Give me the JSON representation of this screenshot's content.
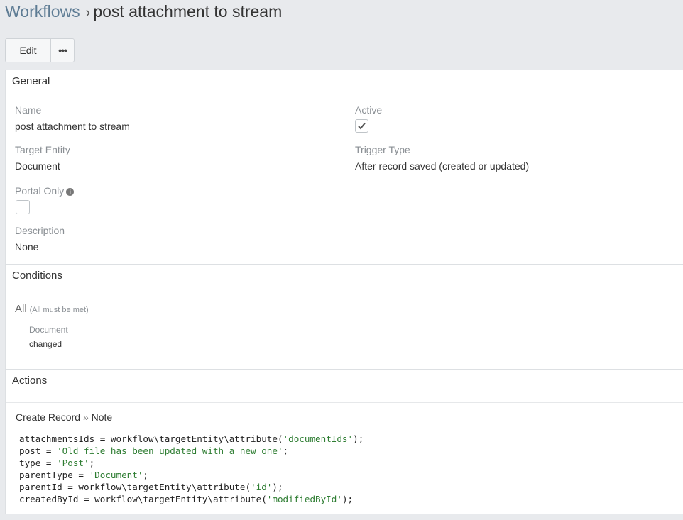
{
  "header": {
    "breadcrumb_link": "Workflows",
    "separator": "›",
    "title": "post attachment to stream"
  },
  "toolbar": {
    "edit_label": "Edit",
    "more_label": "•••"
  },
  "general": {
    "heading": "General",
    "name_label": "Name",
    "name_value": "post attachment to stream",
    "active_label": "Active",
    "active_checked": true,
    "target_entity_label": "Target Entity",
    "target_entity_value": "Document",
    "trigger_type_label": "Trigger Type",
    "trigger_type_value": "After record saved (created or updated)",
    "portal_only_label": "Portal Only",
    "portal_only_info_icon": "i",
    "portal_only_checked": false,
    "description_label": "Description",
    "description_value": "None"
  },
  "conditions": {
    "heading": "Conditions",
    "group_label": "All",
    "group_hint": "(All must be met)",
    "field_label": "Document",
    "field_value": "changed"
  },
  "actions": {
    "heading": "Actions",
    "action_type": "Create Record",
    "action_sep": "»",
    "action_target": "Note",
    "code_lines": [
      {
        "pre": "attachmentsIds = workflow\\targetEntity\\attribute(",
        "str": "'documentIds'",
        "post": ");"
      },
      {
        "pre": "post = ",
        "str": "'Old file has been updated with a new one'",
        "post": ";"
      },
      {
        "pre": "type = ",
        "str": "'Post'",
        "post": ";"
      },
      {
        "pre": "parentType = ",
        "str": "'Document'",
        "post": ";"
      },
      {
        "pre": "parentId = workflow\\targetEntity\\attribute(",
        "str": "'id'",
        "post": ");"
      },
      {
        "pre": "createdById = workflow\\targetEntity\\attribute(",
        "str": "'modifiedById'",
        "post": ");"
      }
    ]
  }
}
